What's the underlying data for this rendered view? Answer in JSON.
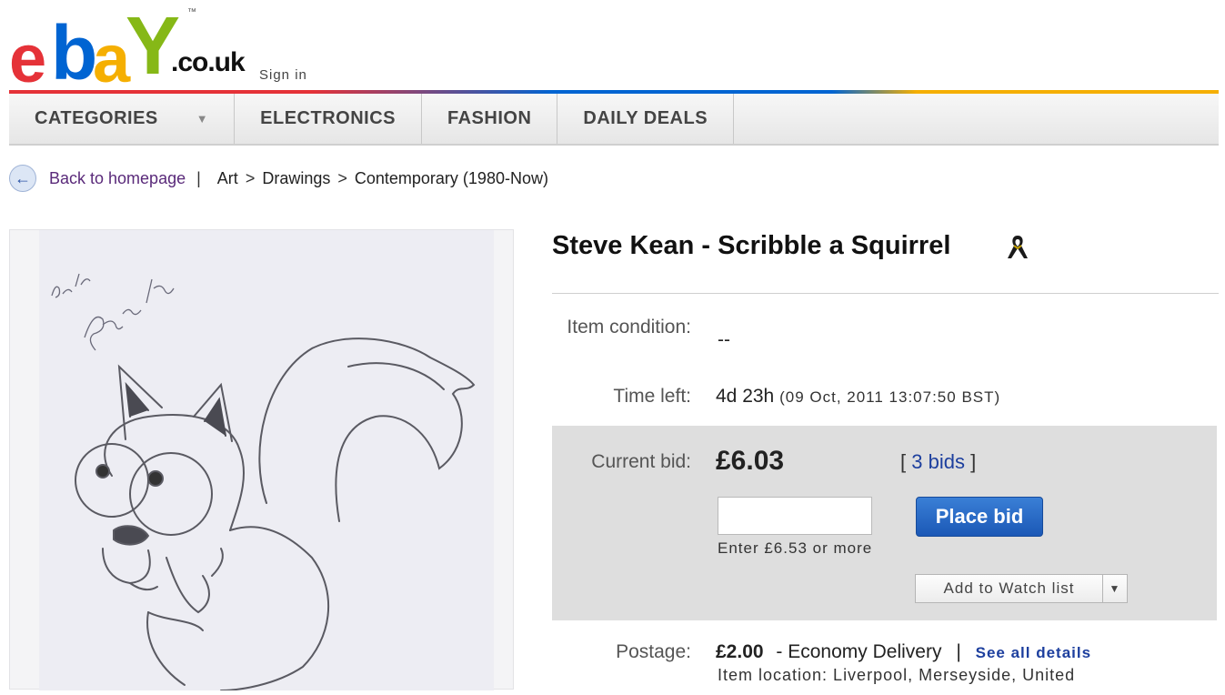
{
  "brand": {
    "logo_letters": [
      "e",
      "b",
      "a",
      "Y"
    ],
    "logo_tm": "™",
    "logo_domain": ".co.uk",
    "sign_in": "Sign in"
  },
  "nav": {
    "items": [
      {
        "label": "CATEGORIES",
        "has_dropdown": true
      },
      {
        "label": "ELECTRONICS"
      },
      {
        "label": "FASHION"
      },
      {
        "label": "DAILY DEALS"
      }
    ]
  },
  "breadcrumb": {
    "back_label": "Back to homepage",
    "separator": "|",
    "path": [
      "Art",
      "Drawings",
      "Contemporary (1980-Now)"
    ],
    "path_separator": ">"
  },
  "listing": {
    "title": "Steve Kean - Scribble a Squirrel",
    "title_icon": "ribbon-icon",
    "item_condition_label": "Item condition:",
    "item_condition_value": "--",
    "time_left_label": "Time left:",
    "time_left_value": "4d 23h",
    "time_left_end": "(09 Oct, 2011 13:07:50 BST)",
    "current_bid_label": "Current bid:",
    "current_bid_value": "£6.03",
    "bids_open": "[",
    "bids_count": "3 bids",
    "bids_close": "]",
    "bid_input_value": "",
    "place_bid_label": "Place bid",
    "bid_hint": "Enter £6.53 or more",
    "watch_label": "Add to Watch list",
    "postage_label": "Postage:",
    "postage_price": "£2.00",
    "postage_service": "- Economy Delivery",
    "postage_sep": "|",
    "see_all_details": "See all details",
    "item_location": "Item location: Liverpool, Merseyside, United"
  },
  "image": {
    "subject": "squirrel-drawing",
    "signature": "best wishes Steve Kean"
  },
  "colors": {
    "ebay_red": "#e53238",
    "ebay_blue": "#0064d2",
    "ebay_yellow": "#f5af02",
    "ebay_green": "#86b817",
    "place_bid_blue": "#1b58b6",
    "link_blue": "#1d3f9e",
    "bid_panel_gray": "#dedede"
  }
}
